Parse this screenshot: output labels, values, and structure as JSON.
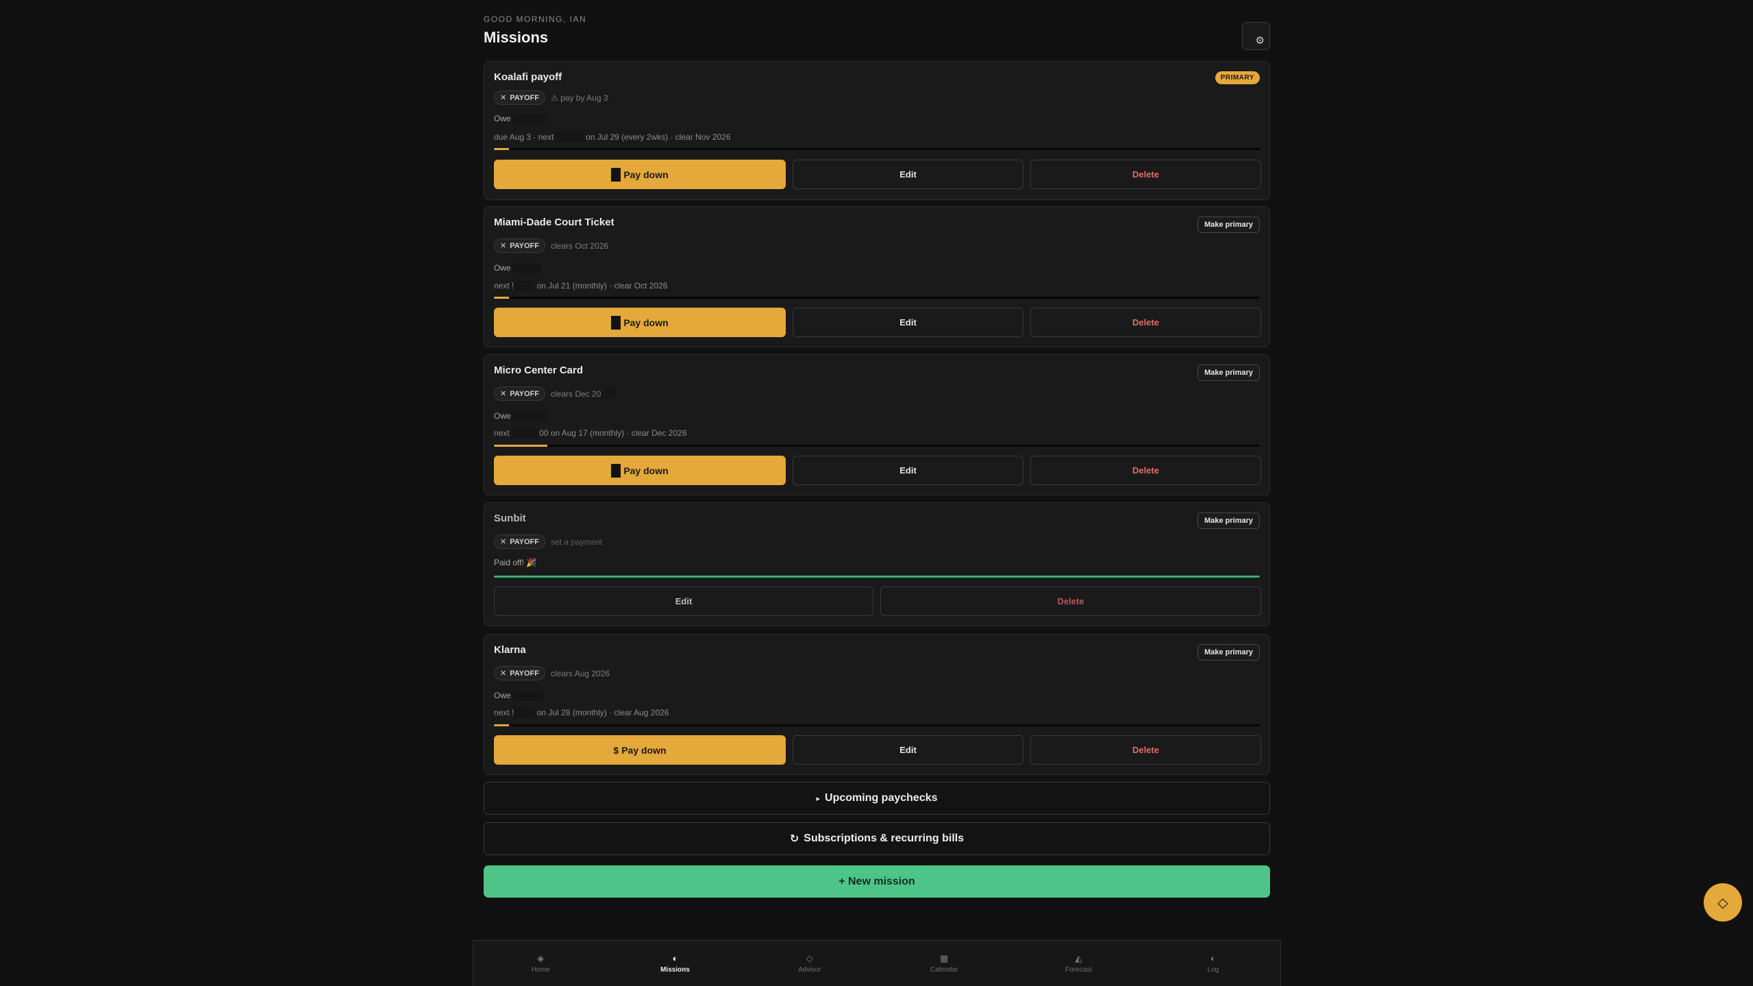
{
  "header": {
    "greeting": "GOOD MORNING, IAN",
    "title": "Missions",
    "settings_icon": "⚙"
  },
  "missions": [
    {
      "name": "Koalafi payoff",
      "badge": "PRIMARY",
      "tag": "PAYOFF",
      "tag_note": "⚠ pay by Aug 3",
      "owe_label": "Owe",
      "sched_a": "due Aug 3 · next",
      "sched_b": "on Jul 29 (every 2wks) · clear Nov 2026",
      "progress": 0.02,
      "pay_label": "Pay down",
      "edit_label": "Edit",
      "delete_label": "Delete"
    },
    {
      "name": "Miami-Dade Court Ticket",
      "badge": "Make primary",
      "tag": "PAYOFF",
      "tag_note": "clears Oct 2026",
      "owe_label": "Owe",
      "sched_a": "next !",
      "sched_b": "on Jul 21 (monthly) · clear Oct 2026",
      "progress": 0.02,
      "pay_label": "Pay down",
      "edit_label": "Edit",
      "delete_label": "Delete"
    },
    {
      "name": "Micro Center Card",
      "badge": "Make primary",
      "tag": "PAYOFF",
      "tag_note": "clears Dec 20",
      "owe_label": "Owe",
      "sched_a": "next",
      "sched_b": "00 on Aug 17 (monthly) · clear Dec 2026",
      "progress": 0.07,
      "pay_label": "Pay down",
      "edit_label": "Edit",
      "delete_label": "Delete"
    },
    {
      "name": "Sunbit",
      "badge": "Make primary",
      "tag": "PAYOFF",
      "tag_note": "set a payment",
      "paid_text": "Paid off! 🎉",
      "progress": 1.0,
      "edit_label": "Edit",
      "delete_label": "Delete"
    },
    {
      "name": "Klarna",
      "badge": "Make primary",
      "tag": "PAYOFF",
      "tag_note": "clears Aug 2026",
      "owe_label": "Owe",
      "sched_a": "next !",
      "sched_b": "on Jul 28 (monthly) · clear Aug 2026",
      "progress": 0.02,
      "pay_label": "Pay down",
      "pay_icon": "$",
      "edit_label": "Edit",
      "delete_label": "Delete"
    }
  ],
  "sections": {
    "paychecks": "Upcoming paychecks",
    "paychecks_icon": "▸",
    "subscriptions": "Subscriptions & recurring bills",
    "subscriptions_icon": "↻",
    "new_mission": "+ New mission"
  },
  "fab_icon": "◇",
  "nav": [
    {
      "label": "Home",
      "icon": "◈"
    },
    {
      "label": "Missions",
      "icon": "◐",
      "active": true
    },
    {
      "label": "Advisor",
      "icon": "◇"
    },
    {
      "label": "Calendar",
      "icon": "▦"
    },
    {
      "label": "Forecast",
      "icon": "◭"
    },
    {
      "label": "Log",
      "icon": "◐"
    }
  ],
  "colors": {
    "accent": "#e4a93a",
    "success": "#4ec588",
    "danger": "#e56a6a",
    "background": "#111111"
  }
}
